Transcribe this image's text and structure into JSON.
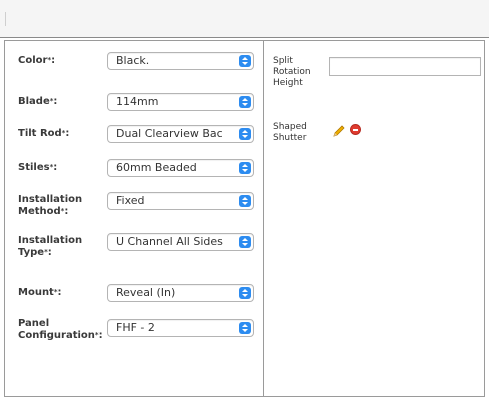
{
  "form": {
    "fields": [
      {
        "label": "Color",
        "value": "Black."
      },
      {
        "label": "Blade",
        "value": "114mm"
      },
      {
        "label": "Tilt Rod",
        "value": "Dual Clearview Bac"
      },
      {
        "label": "Stiles",
        "value": "60mm Beaded"
      },
      {
        "label": "Installation Method",
        "value": "Fixed"
      },
      {
        "label": "Installation Type",
        "value": "U Channel All Sides"
      },
      {
        "label": "Mount",
        "value": "Reveal (In)"
      },
      {
        "label": "Panel Configuration",
        "value": "FHF - 2"
      }
    ],
    "required_mark": "*",
    "label_suffix": ":"
  },
  "right_panel": {
    "split_rotation_label": "Split Rotation Height",
    "split_rotation_value": "",
    "shaped_shutter_label": "Shaped Shutter"
  },
  "icons": {
    "select_arrows": "updown-chevron-icon",
    "edit": "pencil-icon",
    "remove": "remove-icon"
  },
  "colors": {
    "select_button": "#2d8cf0",
    "remove": "#e03b2f",
    "pencil": "#f0b000",
    "border": "#9a9a9a"
  }
}
